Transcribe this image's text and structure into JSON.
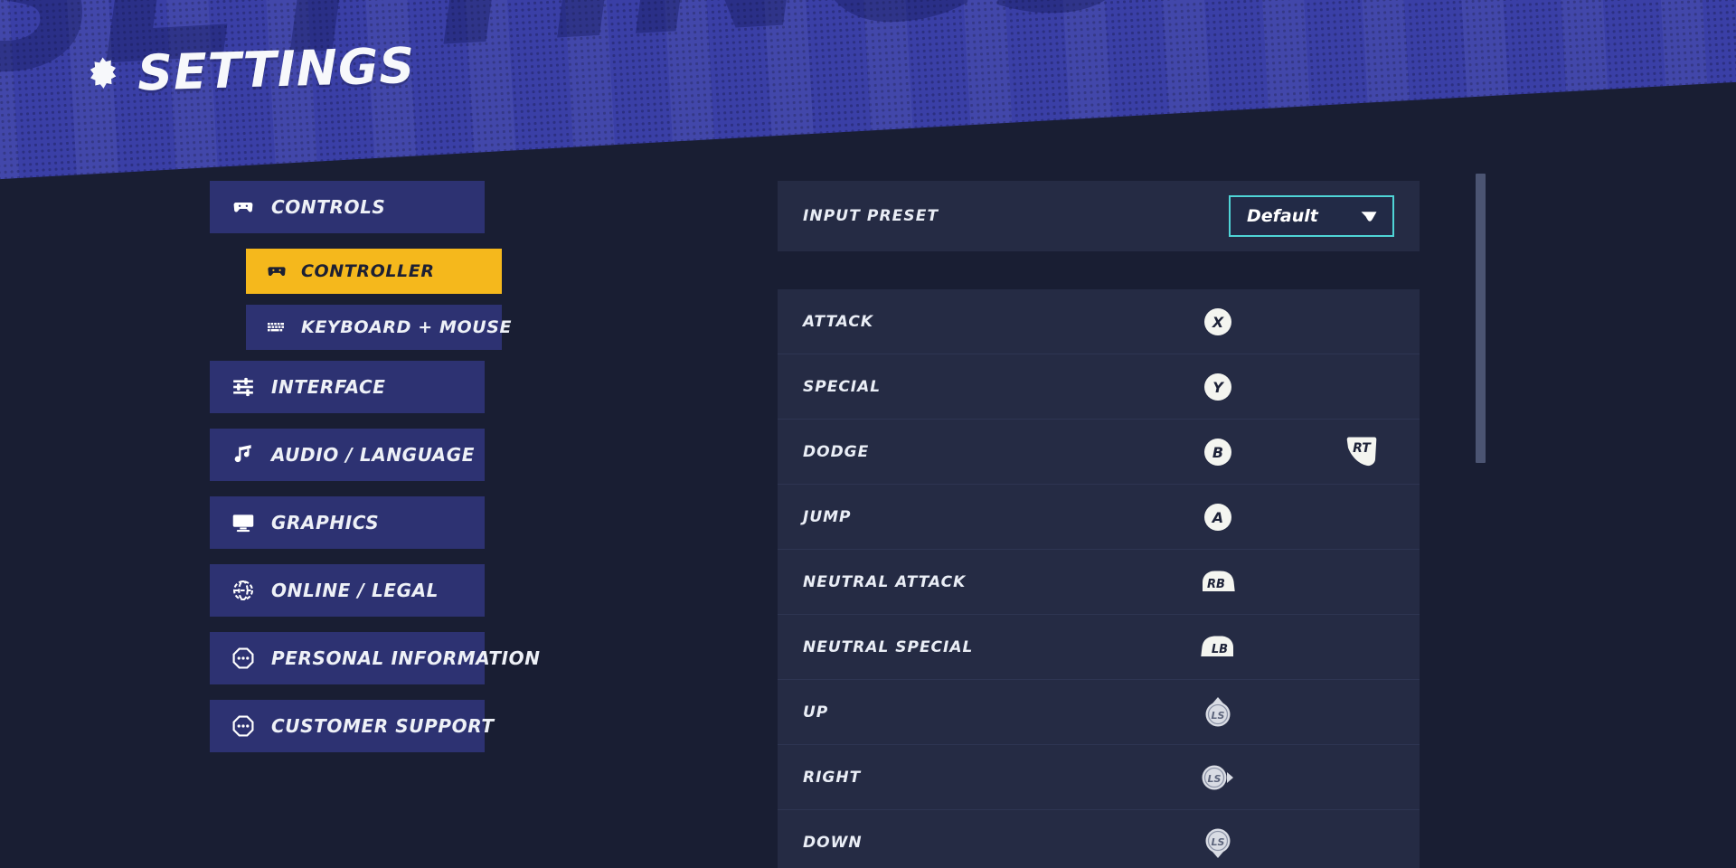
{
  "header": {
    "title": "SETTINGS",
    "ghost_title": "SETTINGS",
    "gear_icon": "gear-icon"
  },
  "sidebar": {
    "items": [
      {
        "label": "CONTROLS",
        "icon": "gamepad-icon",
        "level": "main",
        "active": false
      },
      {
        "label": "CONTROLLER",
        "icon": "gamepad-icon",
        "level": "sub",
        "active": true
      },
      {
        "label": "KEYBOARD + MOUSE",
        "icon": "keyboard-icon",
        "level": "sub",
        "active": false
      },
      {
        "label": "INTERFACE",
        "icon": "sliders-icon",
        "level": "main",
        "active": false
      },
      {
        "label": "AUDIO / LANGUAGE",
        "icon": "music-note-icon",
        "level": "main",
        "active": false
      },
      {
        "label": "GRAPHICS",
        "icon": "monitor-icon",
        "level": "main",
        "active": false
      },
      {
        "label": "ONLINE / LEGAL",
        "icon": "globe-icon",
        "level": "main",
        "active": false
      },
      {
        "label": "PERSONAL INFORMATION",
        "icon": "speech-dots-icon",
        "level": "main",
        "active": false
      },
      {
        "label": "CUSTOMER SUPPORT",
        "icon": "speech-dots-icon",
        "level": "main",
        "active": false
      }
    ]
  },
  "main": {
    "preset": {
      "label": "INPUT PRESET",
      "value": "Default",
      "caret_icon": "chevron-down-icon"
    },
    "bindings": [
      {
        "action": "ATTACK",
        "primary": "X",
        "primary_type": "face",
        "secondary": null,
        "secondary_type": null
      },
      {
        "action": "SPECIAL",
        "primary": "Y",
        "primary_type": "face",
        "secondary": null,
        "secondary_type": null
      },
      {
        "action": "DODGE",
        "primary": "B",
        "primary_type": "face",
        "secondary": "RT",
        "secondary_type": "trigger"
      },
      {
        "action": "JUMP",
        "primary": "A",
        "primary_type": "face",
        "secondary": null,
        "secondary_type": null
      },
      {
        "action": "NEUTRAL ATTACK",
        "primary": "RB",
        "primary_type": "bumper-right",
        "secondary": null,
        "secondary_type": null
      },
      {
        "action": "NEUTRAL SPECIAL",
        "primary": "LB",
        "primary_type": "bumper-left",
        "secondary": null,
        "secondary_type": null
      },
      {
        "action": "UP",
        "primary": "LS",
        "primary_type": "stick-up",
        "secondary": null,
        "secondary_type": null
      },
      {
        "action": "RIGHT",
        "primary": "LS",
        "primary_type": "stick-right",
        "secondary": null,
        "secondary_type": null
      },
      {
        "action": "DOWN",
        "primary": "LS",
        "primary_type": "stick-down",
        "secondary": null,
        "secondary_type": null
      }
    ]
  },
  "colors": {
    "page_bg": "#191e33",
    "panel_bg": "#252b44",
    "banner_blue": "#3a3fa6",
    "nav_blue": "#2d3272",
    "accent_gold": "#f5b81c",
    "accent_cyan": "#4fd4d6",
    "text_light": "#eef1f7",
    "scrollbar": "#4b5472"
  },
  "scrollbar": {
    "name": "content-scrollbar"
  }
}
